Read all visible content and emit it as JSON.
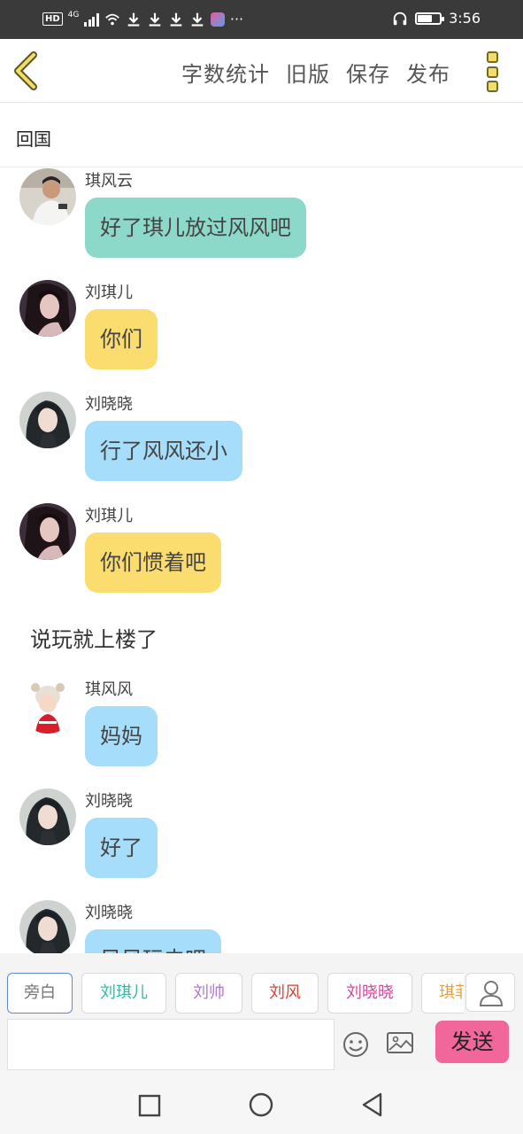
{
  "status_bar": {
    "network_badge": "HD",
    "network_type": "4G",
    "more": "···",
    "time": "3:56",
    "battery_level": 0.65
  },
  "toolbar": {
    "actions": [
      "字数统计",
      "旧版",
      "保存",
      "发布"
    ]
  },
  "story": {
    "title": "回国"
  },
  "messages": [
    {
      "kind": "speech",
      "name": "琪风云",
      "text": "好了琪儿放过风风吧",
      "color": "#8cd9c9",
      "avatar": "man-portrait"
    },
    {
      "kind": "speech",
      "name": "刘琪儿",
      "text": "你们",
      "color": "#fbdc6e",
      "avatar": "woman-portrait"
    },
    {
      "kind": "speech",
      "name": "刘晓晓",
      "text": "行了风风还小",
      "color": "#a6ddfa",
      "avatar": "girl-portrait"
    },
    {
      "kind": "speech",
      "name": "刘琪儿",
      "text": "你们惯着吧",
      "color": "#fbdc6e",
      "avatar": "woman-portrait"
    },
    {
      "kind": "narration",
      "text": "说玩就上楼了"
    },
    {
      "kind": "speech",
      "name": "琪风风",
      "text": "妈妈",
      "color": "#a6ddfa",
      "avatar": "baby-portrait"
    },
    {
      "kind": "speech",
      "name": "刘晓晓",
      "text": "好了",
      "color": "#a6ddfa",
      "avatar": "girl-portrait"
    },
    {
      "kind": "speech",
      "name": "刘晓晓",
      "text": "风风玩去吧",
      "color": "#a6ddfa",
      "avatar": "girl-portrait"
    }
  ],
  "roles": [
    {
      "label": "旁白",
      "color": "#777777",
      "active": true
    },
    {
      "label": "刘琪儿",
      "color": "#3bb8a0",
      "active": false
    },
    {
      "label": "刘帅",
      "color": "#b07ad0",
      "active": false
    },
    {
      "label": "刘风",
      "color": "#d0453a",
      "active": false
    },
    {
      "label": "刘晓晓",
      "color": "#d04a9a",
      "active": false
    },
    {
      "label": "琪菲",
      "color": "#e8a040",
      "active": false
    }
  ],
  "composer": {
    "input_value": "",
    "send_label": "发送"
  }
}
